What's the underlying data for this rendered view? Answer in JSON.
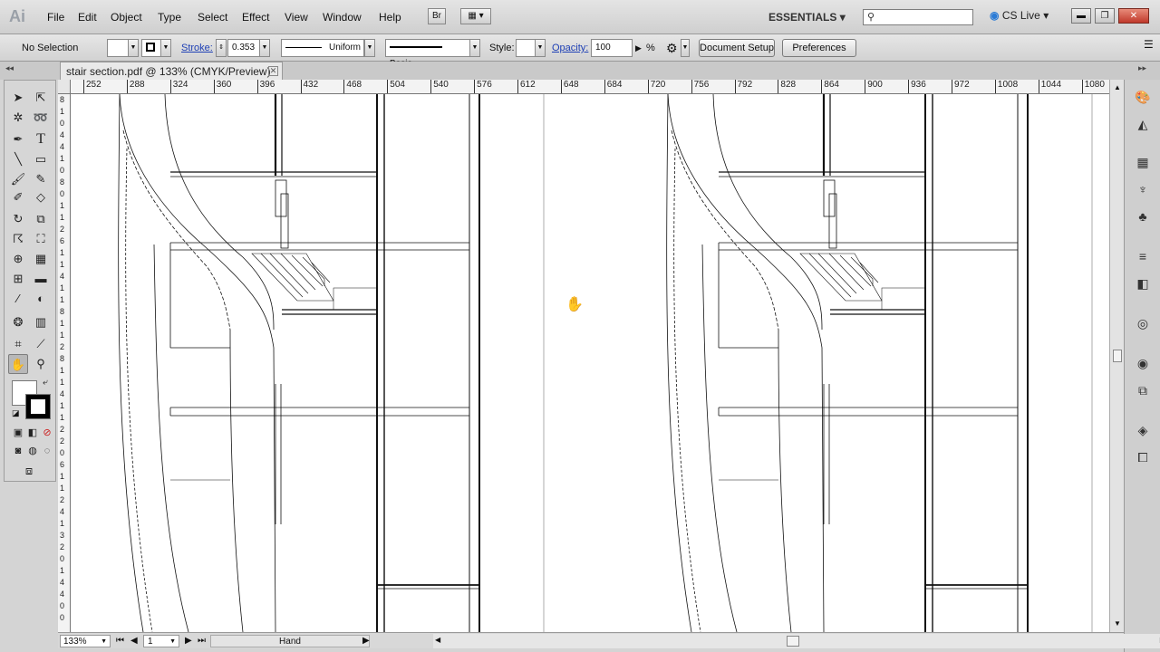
{
  "app": {
    "logo": "Ai",
    "menus": [
      "File",
      "Edit",
      "Object",
      "Type",
      "Select",
      "Effect",
      "View",
      "Window",
      "Help"
    ],
    "bridge_label": "Br",
    "workspace": "ESSENTIALS",
    "search_placeholder": "",
    "cs_live": "CS Live",
    "window_buttons": [
      "minimize",
      "maximize",
      "close"
    ]
  },
  "control_bar": {
    "selection_status": "No Selection",
    "stroke_label": "Stroke:",
    "stroke_weight": "0.353",
    "profile_label": "Uniform",
    "brush_label": "Basic",
    "style_label": "Style:",
    "opacity_label": "Opacity:",
    "opacity_value": "100",
    "opacity_unit": "%",
    "document_setup_label": "Document Setup",
    "preferences_label": "Preferences"
  },
  "document": {
    "tab_title": "stair section.pdf @ 133% (CMYK/Preview)"
  },
  "ruler": {
    "top_ticks": [
      "252",
      "288",
      "324",
      "360",
      "396",
      "432",
      "468",
      "504",
      "540",
      "576",
      "612",
      "648",
      "684",
      "720",
      "756",
      "792",
      "828",
      "864",
      "900",
      "936",
      "972",
      "1008",
      "1044",
      "1080"
    ],
    "left_digits": [
      "8",
      "1",
      "0",
      "4",
      "4",
      "1",
      "0",
      "8",
      "0",
      "1",
      "1",
      "2",
      "6",
      "1",
      "1",
      "4",
      "1",
      "1",
      "8",
      "1",
      "1",
      "2",
      "8",
      "1",
      "1",
      "4",
      "1",
      "1",
      "2",
      "2",
      "0",
      "6",
      "1",
      "1",
      "2",
      "4",
      "1",
      "3",
      "2",
      "0",
      "1",
      "4",
      "4",
      "0",
      "0"
    ]
  },
  "status_bar": {
    "zoom": "133%",
    "artboard": "1",
    "tool_name": "Hand"
  },
  "icons": {
    "tools": [
      "selection-tool",
      "direct-selection-tool",
      "magic-wand-tool",
      "lasso-tool",
      "pen-tool",
      "type-tool",
      "line-tool",
      "rectangle-tool",
      "paintbrush-tool",
      "pencil-tool",
      "blob-brush-tool",
      "eraser-tool",
      "rotate-tool",
      "scale-tool",
      "warp-tool",
      "free-transform-tool",
      "shape-builder-tool",
      "perspective-grid-tool",
      "mesh-tool",
      "gradient-tool",
      "eyedropper-tool",
      "blend-tool",
      "symbol-sprayer-tool",
      "column-graph-tool",
      "artboard-tool",
      "slice-tool",
      "hand-tool",
      "zoom-tool"
    ],
    "panels": [
      "color-panel",
      "color-guide-panel",
      "swatches-panel",
      "brushes-panel",
      "symbols-panel",
      "stroke-panel",
      "gradient-panel",
      "transparency-panel",
      "appearance-panel",
      "graphic-styles-panel",
      "layers-panel",
      "artboards-panel"
    ]
  }
}
